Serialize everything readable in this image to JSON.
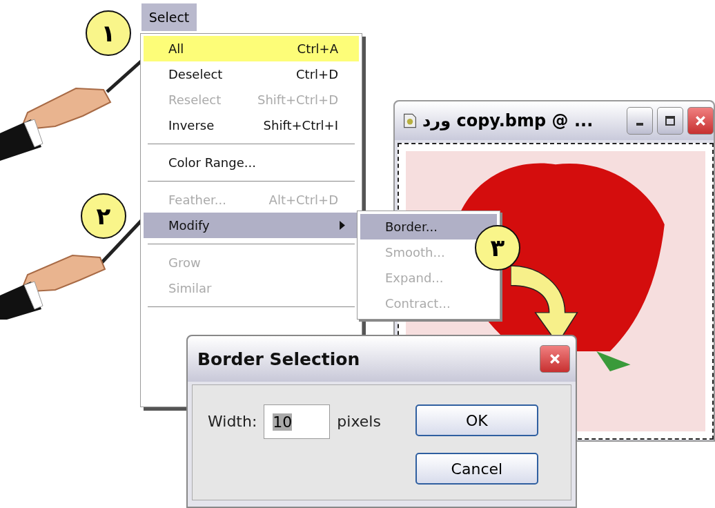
{
  "menu_title": "Select",
  "menu_items": [
    {
      "kind": "item",
      "label": "All",
      "shortcut": "Ctrl+A",
      "disabled": false,
      "marked": true,
      "selected": false,
      "submenu": false
    },
    {
      "kind": "item",
      "label": "Deselect",
      "shortcut": "Ctrl+D",
      "disabled": false,
      "marked": false,
      "selected": false,
      "submenu": false
    },
    {
      "kind": "item",
      "label": "Reselect",
      "shortcut": "Shift+Ctrl+D",
      "disabled": true,
      "marked": false,
      "selected": false,
      "submenu": false
    },
    {
      "kind": "item",
      "label": "Inverse",
      "shortcut": "Shift+Ctrl+I",
      "disabled": false,
      "marked": false,
      "selected": false,
      "submenu": false
    },
    {
      "kind": "separator"
    },
    {
      "kind": "item",
      "label": "Color Range...",
      "disabled": false,
      "marked": false,
      "selected": false,
      "submenu": false
    },
    {
      "kind": "separator"
    },
    {
      "kind": "item",
      "label": "Feather...",
      "shortcut": "Alt+Ctrl+D",
      "disabled": true,
      "marked": false,
      "selected": false,
      "submenu": false
    },
    {
      "kind": "item",
      "label": "Modify",
      "disabled": false,
      "marked": false,
      "selected": true,
      "submenu": true
    },
    {
      "kind": "separator"
    },
    {
      "kind": "item",
      "label": "Grow",
      "disabled": true,
      "marked": false,
      "selected": false,
      "submenu": false
    },
    {
      "kind": "item",
      "label": "Similar",
      "disabled": true,
      "marked": false,
      "selected": false,
      "submenu": false
    },
    {
      "kind": "separator"
    }
  ],
  "submenu_items": [
    {
      "label": "Border...",
      "disabled": false,
      "selected": true
    },
    {
      "label": "Smooth...",
      "disabled": true,
      "selected": false
    },
    {
      "label": "Expand...",
      "disabled": true,
      "selected": false
    },
    {
      "label": "Contract...",
      "disabled": true,
      "selected": false
    }
  ],
  "image_window": {
    "title": "ورد copy.bmp @ ..."
  },
  "dialog": {
    "title": "Border Selection",
    "field_label": "Width:",
    "value": "10",
    "unit": "pixels",
    "buttons": [
      "OK",
      "Cancel"
    ]
  },
  "steps": [
    "١",
    "٢",
    "٣"
  ]
}
